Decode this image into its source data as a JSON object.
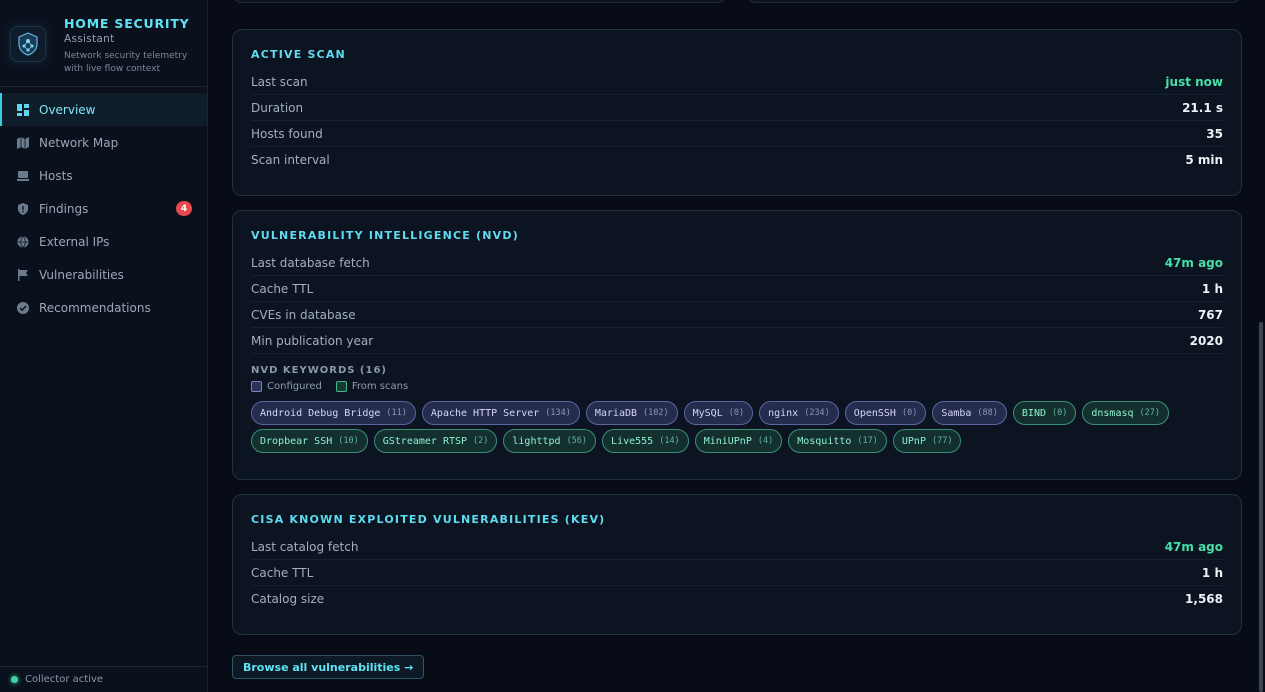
{
  "app": {
    "title": "HOME SECURITY",
    "subtitle": "Assistant",
    "description": "Network security telemetry with live flow context"
  },
  "nav": {
    "items": [
      {
        "label": "Overview",
        "icon": "dashboard-icon",
        "active": true
      },
      {
        "label": "Network Map",
        "icon": "map-icon"
      },
      {
        "label": "Hosts",
        "icon": "server-icon"
      },
      {
        "label": "Findings",
        "icon": "shield-icon",
        "badge": "4"
      },
      {
        "label": "External IPs",
        "icon": "globe-icon"
      },
      {
        "label": "Vulnerabilities",
        "icon": "flag-icon"
      },
      {
        "label": "Recommendations",
        "icon": "check-circle-icon"
      }
    ]
  },
  "footer": {
    "status": "Collector active"
  },
  "active_scan": {
    "title": "ACTIVE SCAN",
    "rows": [
      {
        "label": "Last scan",
        "value": "just now"
      },
      {
        "label": "Duration",
        "value": "21.1 s"
      },
      {
        "label": "Hosts found",
        "value": "35"
      },
      {
        "label": "Scan interval",
        "value": "5 min"
      }
    ]
  },
  "nvd": {
    "title": "VULNERABILITY INTELLIGENCE (NVD)",
    "rows": [
      {
        "label": "Last database fetch",
        "value": "47m ago"
      },
      {
        "label": "Cache TTL",
        "value": "1 h"
      },
      {
        "label": "CVEs in database",
        "value": "767"
      },
      {
        "label": "Min publication year",
        "value": "2020"
      }
    ],
    "keywords_title": "NVD KEYWORDS (16)",
    "legend": {
      "configured": "Configured",
      "from_scans": "From scans"
    },
    "keywords": [
      {
        "name": "Android Debug Bridge",
        "count": "(11)",
        "source": "configured"
      },
      {
        "name": "Apache HTTP Server",
        "count": "(134)",
        "source": "configured"
      },
      {
        "name": "MariaDB",
        "count": "(102)",
        "source": "configured"
      },
      {
        "name": "MySQL",
        "count": "(0)",
        "source": "configured"
      },
      {
        "name": "nginx",
        "count": "(234)",
        "source": "configured"
      },
      {
        "name": "OpenSSH",
        "count": "(0)",
        "source": "configured"
      },
      {
        "name": "Samba",
        "count": "(88)",
        "source": "configured"
      },
      {
        "name": "BIND",
        "count": "(0)",
        "source": "scan"
      },
      {
        "name": "dnsmasq",
        "count": "(27)",
        "source": "scan"
      },
      {
        "name": "Dropbear SSH",
        "count": "(10)",
        "source": "scan"
      },
      {
        "name": "GStreamer RTSP",
        "count": "(2)",
        "source": "scan"
      },
      {
        "name": "lighttpd",
        "count": "(56)",
        "source": "scan"
      },
      {
        "name": "Live555",
        "count": "(14)",
        "source": "scan"
      },
      {
        "name": "MiniUPnP",
        "count": "(4)",
        "source": "scan"
      },
      {
        "name": "Mosquitto",
        "count": "(17)",
        "source": "scan"
      },
      {
        "name": "UPnP",
        "count": "(77)",
        "source": "scan"
      }
    ]
  },
  "kev": {
    "title": "CISA KNOWN EXPLOITED VULNERABILITIES (KEV)",
    "rows": [
      {
        "label": "Last catalog fetch",
        "value": "47m ago"
      },
      {
        "label": "Cache TTL",
        "value": "1 h"
      },
      {
        "label": "Catalog size",
        "value": "1,568"
      }
    ]
  },
  "browse_button": "Browse all vulnerabilities →",
  "colors": {
    "accent": "#5fe3f5",
    "positive": "#46e0a8",
    "badge": "#e5484d"
  }
}
